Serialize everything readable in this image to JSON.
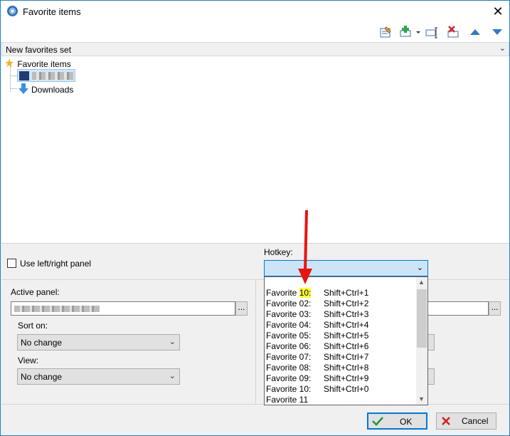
{
  "window": {
    "title": "Favorite items"
  },
  "toolbar": {
    "icons": [
      "edit-icon",
      "add-icon",
      "dropdown-caret-icon",
      "rename-icon",
      "delete-icon",
      "move-up-icon",
      "move-down-icon"
    ]
  },
  "favorites_set": {
    "value": "New favorites set"
  },
  "tree": {
    "root": "Favorite items",
    "children": [
      {
        "label": "",
        "obscured": true
      },
      {
        "label": "Downloads"
      }
    ]
  },
  "options": {
    "use_left_right_panel": "Use left/right panel",
    "checked": false
  },
  "hotkey": {
    "label": "Hotkey:",
    "value": "",
    "items": [
      {
        "name": "Favorite ",
        "highlight": "10:",
        "key": "Shift+Ctrl+1"
      },
      {
        "name": "Favorite 02:",
        "highlight": "",
        "key": "Shift+Ctrl+2"
      },
      {
        "name": "Favorite 03:",
        "highlight": "",
        "key": "Shift+Ctrl+3"
      },
      {
        "name": "Favorite 04:",
        "highlight": "",
        "key": "Shift+Ctrl+4"
      },
      {
        "name": "Favorite 05:",
        "highlight": "",
        "key": "Shift+Ctrl+5"
      },
      {
        "name": "Favorite 06:",
        "highlight": "",
        "key": "Shift+Ctrl+6"
      },
      {
        "name": "Favorite 07:",
        "highlight": "",
        "key": "Shift+Ctrl+7"
      },
      {
        "name": "Favorite 08:",
        "highlight": "",
        "key": "Shift+Ctrl+8"
      },
      {
        "name": "Favorite 09:",
        "highlight": "",
        "key": "Shift+Ctrl+9"
      },
      {
        "name": "Favorite 10:",
        "highlight": "",
        "key": "Shift+Ctrl+0"
      },
      {
        "name": "Favorite 11",
        "highlight": "",
        "key": ""
      }
    ]
  },
  "active_panel": {
    "label": "Active panel:",
    "path_obscured": true,
    "browse_label": "...",
    "sort_label": "Sort on:",
    "sort_value": "No change",
    "view_label": "View:",
    "view_value": "No change"
  },
  "inactive_panel": {
    "browse_label": "..."
  },
  "buttons": {
    "ok": "OK",
    "cancel": "Cancel"
  },
  "colors": {
    "accent": "#0078d7",
    "highlight": "#ffff32",
    "annotation_arrow": "#e8140f"
  }
}
